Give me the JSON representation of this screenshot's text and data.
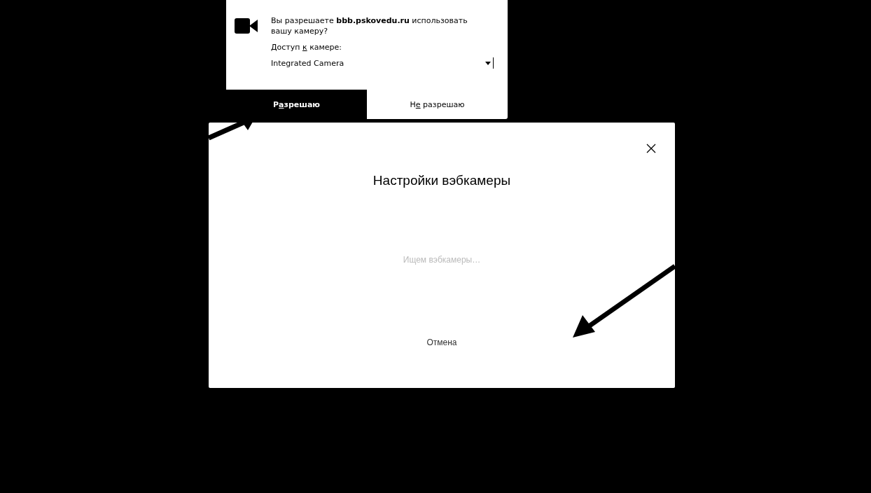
{
  "permission_prompt": {
    "message": "Вы разрешаете **bbb.pskovedu.ru** использовать вашу камеру?",
    "access_label": {
      "before": "Доступ ",
      "key": "к",
      "after": " камере:"
    },
    "device_select": {
      "value": "Integrated Camera"
    },
    "buttons": [
      {
        "before": "Р",
        "key": "а",
        "after": "зрешаю",
        "selected": true
      },
      {
        "before": "Н",
        "key": "е",
        "after": " разрешаю",
        "selected": false
      }
    ]
  },
  "dialog": {
    "title": "Настройки вэбкамеры",
    "status": "Ищем вэбкамеры…",
    "cancel": "Отмена"
  }
}
